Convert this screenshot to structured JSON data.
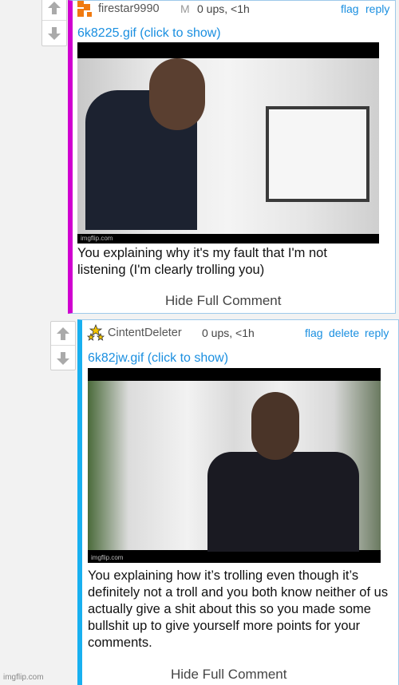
{
  "comments": [
    {
      "username": "firestar9990",
      "badge": "M",
      "meta": "0 ups, <1h",
      "actions": [
        "flag",
        "reply"
      ],
      "gif_link": "6k8225.gif (click to show)",
      "gif_watermark": "imgflip.com",
      "caption": "You explaining why it's my fault that I'm not listening (I'm clearly trolling you)",
      "hide_label": "Hide Full Comment",
      "accent": "#d000d0"
    },
    {
      "username": "CintentDeleter",
      "meta": "0 ups, <1h",
      "actions": [
        "flag",
        "delete",
        "reply"
      ],
      "gif_link": "6k82jw.gif (click to show)",
      "gif_watermark": "imgflip.com",
      "caption": "You explaining how it’s trolling even though it’s definitely not a troll and you both know neither of us actually give a shit about this so you made some bullshit up to give yourself more points for your comments.",
      "hide_label": "Hide Full Comment",
      "accent": "#18b0f0"
    }
  ],
  "watermark": "imgflip.com"
}
